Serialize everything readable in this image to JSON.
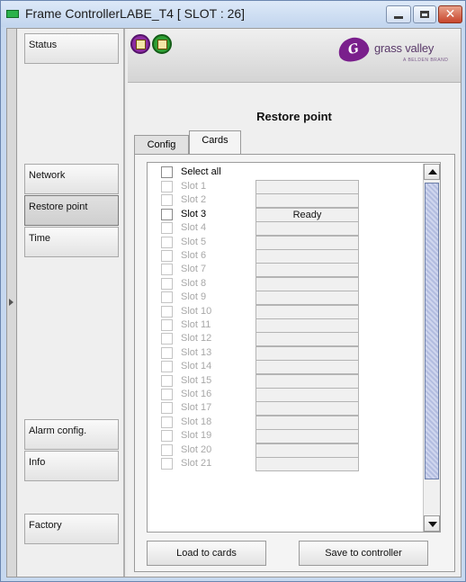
{
  "window": {
    "title": "Frame ControllerLABE_T4 [ SLOT : 26]"
  },
  "nav": {
    "items": [
      {
        "label": "Status"
      },
      {
        "label": "Network"
      },
      {
        "label": "Restore point"
      },
      {
        "label": "Time"
      },
      {
        "label": "Alarm config."
      },
      {
        "label": "Info"
      },
      {
        "label": "Factory"
      }
    ]
  },
  "header": {
    "status_icons": [
      "alarm-status-icon",
      "ok-status-icon"
    ],
    "logo": {
      "text": "grass valley",
      "sub": "A BELDEN BRAND"
    }
  },
  "panel": {
    "title": "Restore point",
    "tabs": [
      {
        "label": "Config"
      },
      {
        "label": "Cards"
      }
    ],
    "select_all_label": "Select all",
    "slots": [
      {
        "label": "Slot 1",
        "status": "",
        "enabled": false
      },
      {
        "label": "Slot 2",
        "status": "",
        "enabled": false
      },
      {
        "label": "Slot 3",
        "status": "Ready",
        "enabled": true
      },
      {
        "label": "Slot 4",
        "status": "",
        "enabled": false
      },
      {
        "label": "Slot 5",
        "status": "",
        "enabled": false
      },
      {
        "label": "Slot 6",
        "status": "",
        "enabled": false
      },
      {
        "label": "Slot 7",
        "status": "",
        "enabled": false
      },
      {
        "label": "Slot 8",
        "status": "",
        "enabled": false
      },
      {
        "label": "Slot 9",
        "status": "",
        "enabled": false
      },
      {
        "label": "Slot 10",
        "status": "",
        "enabled": false
      },
      {
        "label": "Slot 11",
        "status": "",
        "enabled": false
      },
      {
        "label": "Slot 12",
        "status": "",
        "enabled": false
      },
      {
        "label": "Slot 13",
        "status": "",
        "enabled": false
      },
      {
        "label": "Slot 14",
        "status": "",
        "enabled": false
      },
      {
        "label": "Slot 15",
        "status": "",
        "enabled": false
      },
      {
        "label": "Slot 16",
        "status": "",
        "enabled": false
      },
      {
        "label": "Slot 17",
        "status": "",
        "enabled": false
      },
      {
        "label": "Slot 18",
        "status": "",
        "enabled": false
      },
      {
        "label": "Slot 19",
        "status": "",
        "enabled": false
      },
      {
        "label": "Slot 20",
        "status": "",
        "enabled": false
      },
      {
        "label": "Slot 21",
        "status": "",
        "enabled": false
      }
    ],
    "buttons": {
      "load": "Load to cards",
      "save": "Save to controller"
    }
  },
  "colors": {
    "window_frame": "#c6d8ef",
    "brand": "#7a1f8c",
    "scroll_thumb": "#b3bde0"
  }
}
